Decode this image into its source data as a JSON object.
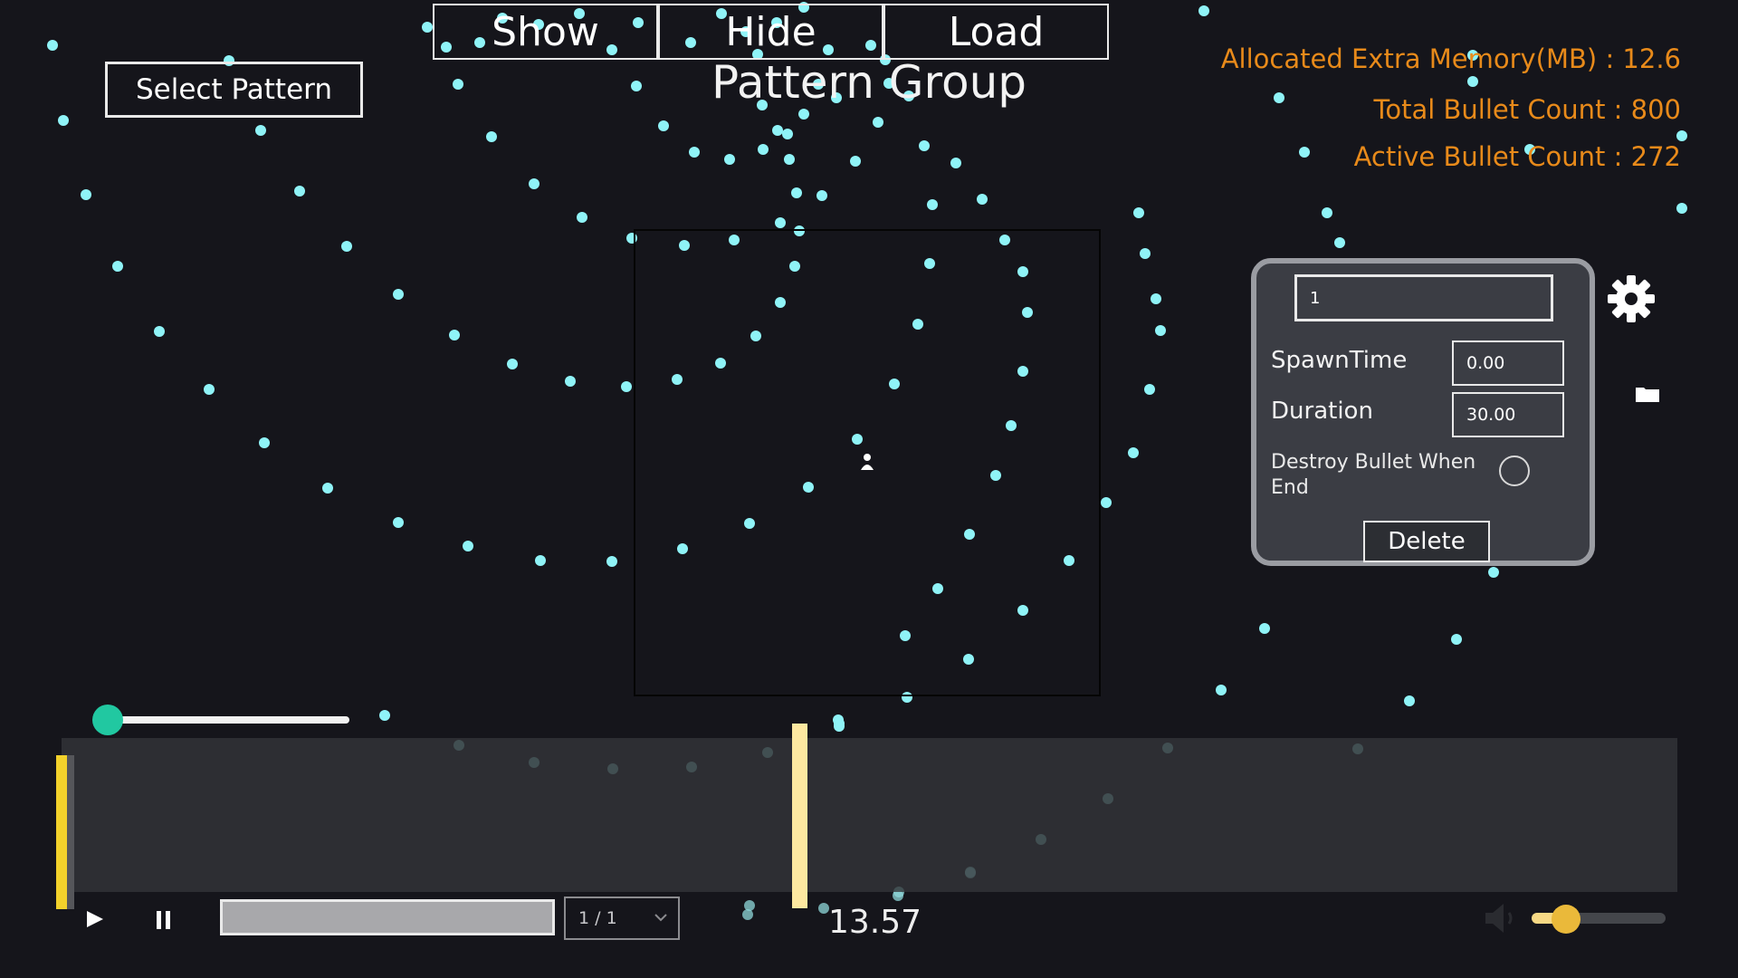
{
  "toolbar": {
    "show_label": "Show",
    "hide_label": "Hide",
    "load_label": "Load"
  },
  "title": "Pattern Group",
  "select_pattern_label": "Select Pattern",
  "stats": {
    "allocated_memory": "Allocated Extra Memory(MB) : 12.6",
    "total_bullets": "Total Bullet Count : 800",
    "active_bullets": "Active Bullet Count : 272"
  },
  "panel": {
    "name_value": "1",
    "spawn_time_label": "SpawnTime",
    "spawn_time_value": "0.00",
    "duration_label": "Duration",
    "duration_value": "30.00",
    "destroy_label": "Destroy Bullet When End",
    "destroy_checked": false,
    "delete_label": "Delete"
  },
  "icons": {
    "settings": "gear-icon",
    "folder": "folder-icon",
    "player": "player-icon",
    "play": "play-icon",
    "pause": "pause-icon",
    "volume": "speaker-icon",
    "dropdown": "chevron-down-icon"
  },
  "playback": {
    "speed_level": 0.0,
    "time": "13.57",
    "page": "1 / 1",
    "volume_level": 0.15
  },
  "colors": {
    "background": "#15151b",
    "bullet": "#8ff3f7",
    "stats_text": "#e88a1a",
    "slider_knob": "#21c8a1",
    "playhead": "#fde8a0",
    "timeline_marker": "#f3d22b",
    "volume_knob": "#eab93a"
  }
}
